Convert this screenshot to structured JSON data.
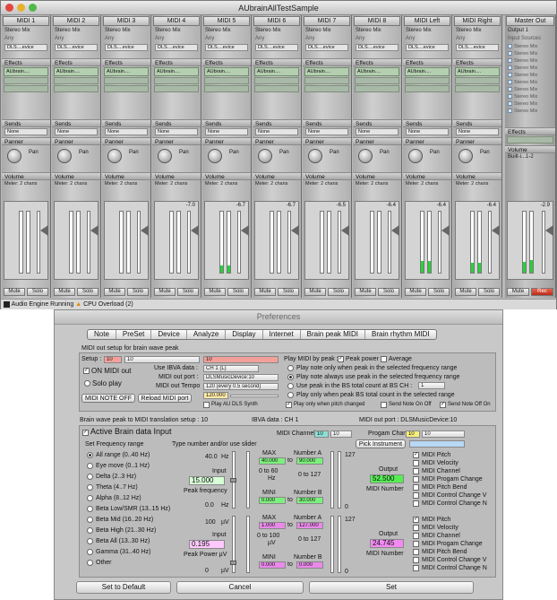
{
  "window": {
    "title": "AUbrainAllTestSample"
  },
  "channels": [
    {
      "name": "MIDI 1",
      "db": "",
      "fx": "AUbrain....",
      "level": 0
    },
    {
      "name": "MIDI 2",
      "db": "",
      "fx": "AUbrain....",
      "level": 0
    },
    {
      "name": "MIDI 3",
      "db": "",
      "fx": "AUbrain....",
      "level": 0
    },
    {
      "name": "MIDI 4",
      "db": "-7.0",
      "fx": "AUbrain....",
      "level": 0
    },
    {
      "name": "MIDI 5",
      "db": "-6.7",
      "fx": "AUbrain....",
      "level": 0.12
    },
    {
      "name": "MIDI 6",
      "db": "-6.7",
      "fx": "AUbrain....",
      "level": 0
    },
    {
      "name": "MIDI 7",
      "db": "-6.5",
      "fx": "AUbrain....",
      "level": 0
    },
    {
      "name": "MIDI 8",
      "db": "-6.4",
      "fx": "AUbrain....",
      "level": 0
    },
    {
      "name": "MIDI Left",
      "db": "-6.4",
      "fx": "AUbrain....",
      "level": 0.18
    },
    {
      "name": "MIDI Right",
      "db": "-6.4",
      "fx": "AUbrain....",
      "level": 0.15
    }
  ],
  "strip": {
    "stereo_mix": "Stereo Mix",
    "any": "Any",
    "device": "DLS....evice",
    "effects": "Effects",
    "sends": "Sends",
    "none": "None",
    "panner": "Panner",
    "pan": "Pan",
    "volume": "Volume",
    "meter": "Meter: 2 chans",
    "mute": "Mute",
    "solo": "Solo",
    "rec": "Rec",
    "scale": "12 6 0 -6 -12 -18 -24 -30 -36 -42 -48"
  },
  "master": {
    "name": "Master Out",
    "output": "Output 1",
    "input_sources": "Input Sources",
    "sources": [
      "Stereo Mix",
      "Stereo Mix",
      "Stereo Mix",
      "Stereo Mix",
      "Stereo Mix",
      "Stereo Mix",
      "Stereo Mix",
      "Stereo Mix",
      "Stereo Mix",
      "Stereo Mix"
    ],
    "effects": "Effects",
    "volume": "Volume",
    "out": "Built-i...1-2",
    "db": "-2.9"
  },
  "status": {
    "engine": "Audio Engine Running",
    "cpu": "CPU Overload (2)"
  },
  "prefs": {
    "title": "Preferences",
    "tabs": [
      "Note",
      "PreSet",
      "Device",
      "Analyze",
      "Display",
      "Internet",
      "Brain peak MIDI",
      "Brain rhythm MIDI"
    ],
    "midi_out_setup": "MIDI out setup for brain wave peak",
    "setup_label": "Setup :",
    "setup_val": "10",
    "setup_sel": "10",
    "setup_name": "10",
    "on_midi_out": "ON MIDI out",
    "solo_play": "Solo play",
    "use_ibva": "Use IBVA data :",
    "ibva_ch": "CH 1 (L)",
    "midi_out_port": "MIDI out port :",
    "port_val": "DLSMusicDevice:10",
    "midi_out_tempo": "MIDI out Tempo",
    "tempo_val": "120 (every 0.5 second)",
    "tempo_num": "120.000",
    "play_au": "Play AU DLS Synth",
    "midi_note_off": "MIDI NOTE OFF",
    "reload_port": "Reload MIDI port",
    "play_by_peak": "Play MIDI by peak :",
    "peak_power": "Peak power",
    "average": "Average",
    "radio_opts": [
      "Play note only when peak in the selected frequency range",
      "Play note always use peak in the selected frequency range",
      "Use peak in the BS total count at BS CH :",
      "Play only when peak BS total count in the selected range"
    ],
    "bs_ch": "1",
    "play_pitch_changed": "Play only when pitch changed",
    "send_note_on_off": "Send Note On Off",
    "send_note_off_on": "Send Note Off On",
    "translation": "Brain wave peak to MIDI translation setup : 10",
    "ibva_data": "IBVA data : CH 1",
    "midi_out_port2": "MIDI out port : DLSMusicDevice:10",
    "active_brain": "Active Brain data Input",
    "midi_channel": "MIDI Channel",
    "channel_val": "10",
    "channel_sel": "10",
    "program_change": "Progam Change",
    "program_val": "10",
    "program_sel": "10",
    "pick_instrument": "Pick Instrument",
    "set_freq": "Set Frequency range",
    "type_number": "Type number and/or use slider",
    "freq_ranges": [
      "All range (0..40 Hz)",
      "Eye move (0..1 Hz)",
      "Delta (2..3 Hz)",
      "Theta (4..7 Hz)",
      "Alpha (8..12 Hz)",
      "Beta Low/SMR (13..15 Hz)",
      "Beta Mid (16..20 Hz)",
      "Beta High (21..30 Hz)",
      "Beta All (13..30 Hz)",
      "Gamma (31..40 Hz)",
      "Other"
    ],
    "freq_max": "40.0",
    "hz": "Hz",
    "freq_min": "0.0",
    "input": "Input",
    "freq_input": "15.000",
    "peak_freq": "Peak frequency",
    "max": "MAX",
    "mini": "MINI",
    "number_a": "Number A",
    "number_b": "Number B",
    "to": "to",
    "fmax": "40.000",
    "fmin": "0.000",
    "na": "90.000",
    "nb": "30.000",
    "range_60": "0 to 60",
    "hz2": "Hz",
    "range_127": "0 to 127",
    "v127": "127",
    "v0": "0",
    "output": "Output",
    "out1": "52.500",
    "midi_number": "MIDI Number",
    "pow_max": "100",
    "uv": "µV",
    "pow_min": "0",
    "pow_input": "0.195",
    "peak_power_uv": "Peak Power µV",
    "pmax": "1.000",
    "pmin": "0.000",
    "pa": "127.000",
    "pb": "0.000",
    "range_100": "0 to 100",
    "uv2": "µV",
    "out2": "24.745",
    "midi_params1": [
      "MIDI Pitch",
      "MIDI Velocity",
      "MIDI Channel",
      "MIDI Progam Change",
      "MIDI Pitch Bend",
      "MIDI Control Change V",
      "MIDI Control Change N"
    ],
    "midi_params2": [
      "MIDI Pitch",
      "MIDI Velocity",
      "MIDI Channel",
      "MIDI Progam Change",
      "MIDI Pitch Bend",
      "MIDI Control Change V",
      "MIDI Control Change N"
    ],
    "set_default": "Set to Default",
    "cancel": "Cancel",
    "set": "Set"
  }
}
